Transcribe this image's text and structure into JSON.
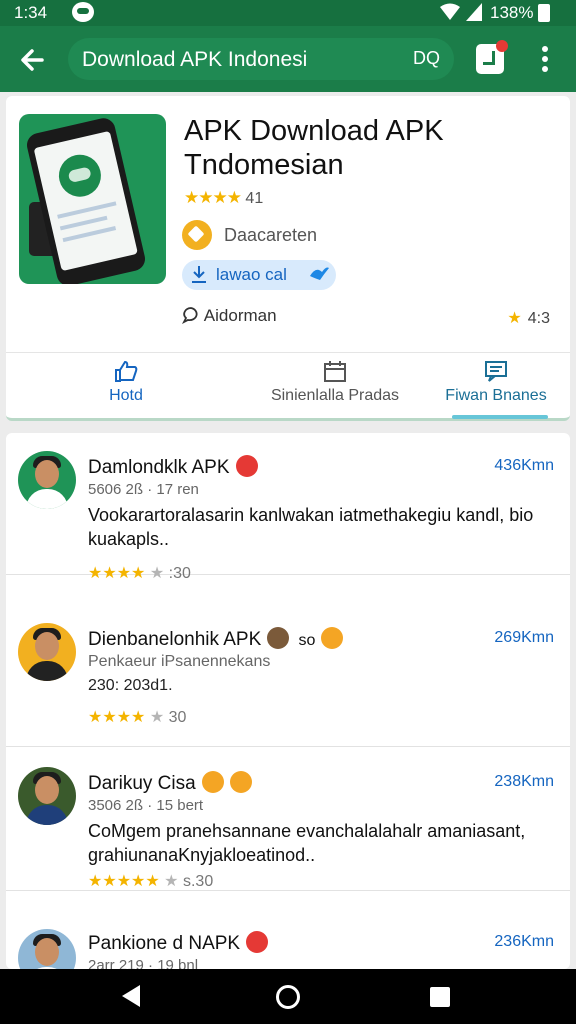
{
  "status_bar": {
    "time": "1:34",
    "battery": "138%"
  },
  "app_bar": {
    "search_text": "Download APK Indonesi",
    "search_action": "DQ",
    "icons": [
      "back-arrow-icon",
      "bookmark-icon",
      "more-vert-icon"
    ]
  },
  "app": {
    "title": "APK Download APK Tndomesian",
    "stars": "★★★★",
    "rating": "41",
    "developer": "Daacareten",
    "install_label": "lawao cal",
    "category": "Aidorman",
    "score": "4:3"
  },
  "tabs": [
    {
      "label": "Hotd",
      "icon": "thumb-up-icon"
    },
    {
      "label": "Sinienlalla Pradas",
      "icon": "calendar-icon"
    },
    {
      "label": "Fiwan Bnanes",
      "icon": "message-icon"
    }
  ],
  "reviews": [
    {
      "name": "Damlondklk APK",
      "distance": "436Kmn",
      "meta": "5606 2ß · 17 ren",
      "text": "Vookarartoralasarin kanlwakan iatmethakegiu kandl, bio kuakapls..",
      "stars_on": "★★★★",
      "stars_off": "★",
      "score": ":30",
      "emoji_color": "#e53935"
    },
    {
      "name": "Dienbanelonhik APK",
      "name_extra": "so",
      "distance": "269Kmn",
      "meta": "Penkaeur iPsanennekans",
      "meta2": "230: 203d1.",
      "stars_on": "★★★★",
      "stars_off": "★",
      "score": "30",
      "emoji_color": "#f4a524"
    },
    {
      "name": "Darikuy Cisa",
      "distance": "238Kmn",
      "meta": "3506 2ß · 15 bert",
      "text": "CoMgem pranehsannane evanchalalahalr amaniasant, grahiunanaKnyjakloeatinod..",
      "stars_on": "★★★★★",
      "stars_off": "★",
      "score": "s.30",
      "emoji_color": "#f4a524"
    },
    {
      "name": "Pankione d NAPK",
      "distance": "236Kmn",
      "meta": "2arr 219 · 19 bnl",
      "emoji_color": "#e53935"
    }
  ]
}
